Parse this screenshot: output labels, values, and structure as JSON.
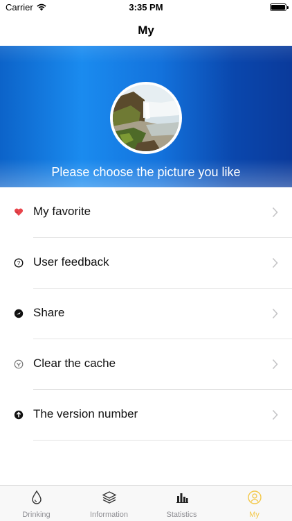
{
  "status_bar": {
    "carrier": "Carrier",
    "time": "3:35 PM"
  },
  "nav": {
    "title": "My"
  },
  "banner": {
    "caption": "Please choose the picture you like"
  },
  "menu": [
    {
      "label": "My favorite",
      "icon": "heart-icon"
    },
    {
      "label": "User feedback",
      "icon": "feedback-icon"
    },
    {
      "label": "Share",
      "icon": "share-icon"
    },
    {
      "label": "Clear the cache",
      "icon": "clear-cache-icon"
    },
    {
      "label": "The version number",
      "icon": "version-icon"
    }
  ],
  "tabs": [
    {
      "label": "Drinking",
      "icon": "water-drop-icon"
    },
    {
      "label": "Information",
      "icon": "layers-icon"
    },
    {
      "label": "Statistics",
      "icon": "bar-chart-icon"
    },
    {
      "label": "My",
      "icon": "user-icon",
      "active": true
    }
  ],
  "colors": {
    "accent": "#f3c84a",
    "banner_blue": "#1372dc",
    "inactive": "#8e8e93"
  }
}
